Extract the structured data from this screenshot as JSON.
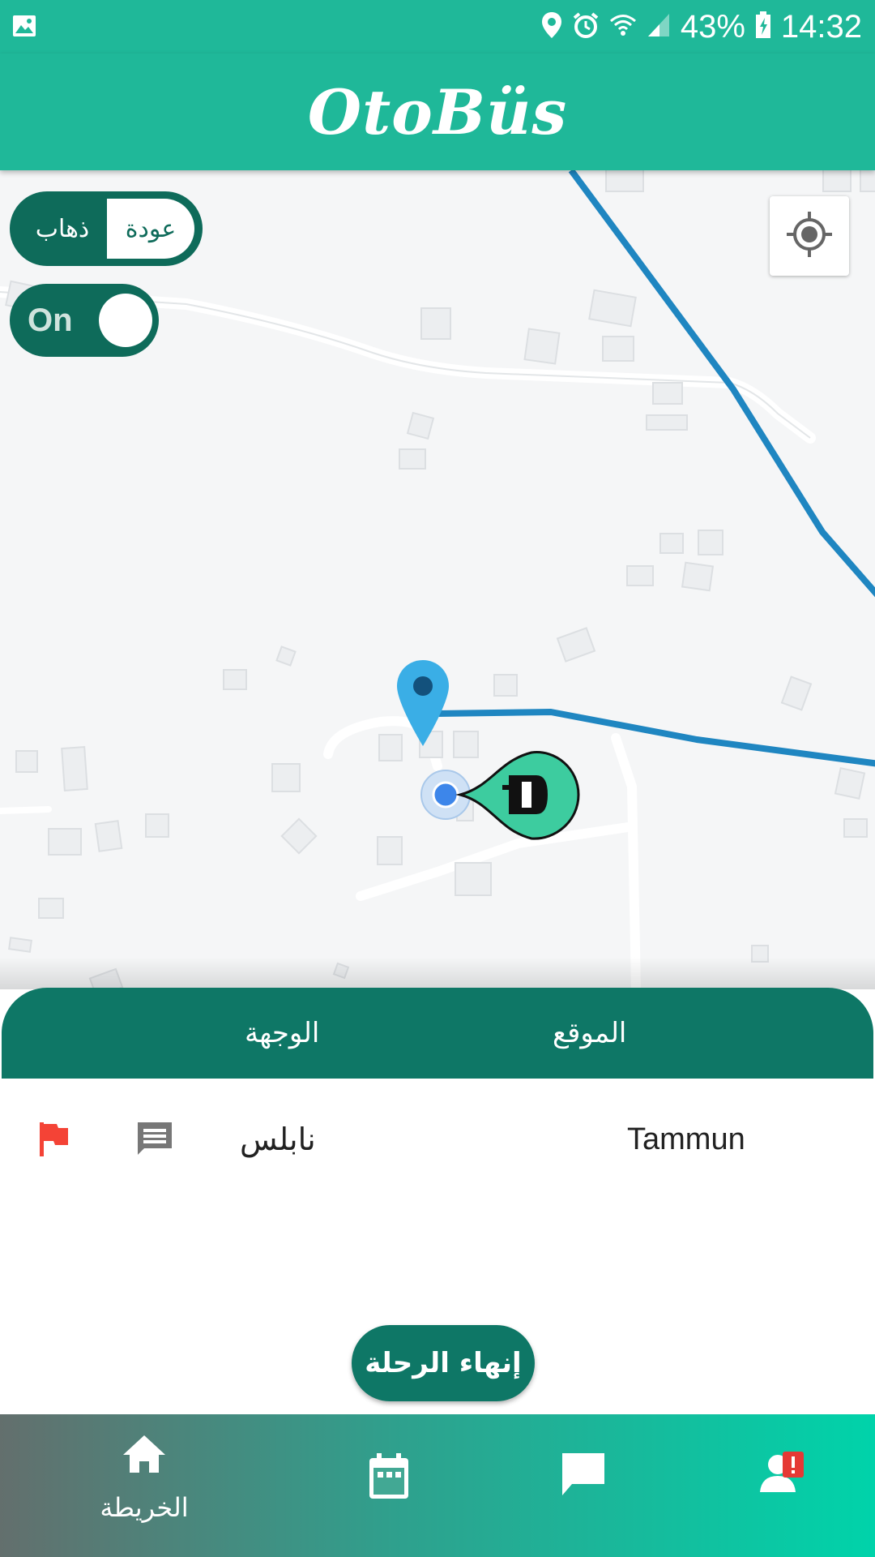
{
  "status_bar": {
    "battery": "43%",
    "time": "14:32",
    "icons": [
      "image-icon",
      "location-icon",
      "alarm-icon",
      "wifi-icon",
      "signal-icon",
      "battery-charging-icon"
    ]
  },
  "app_bar": {
    "title": "OtoBüs"
  },
  "map": {
    "direction_toggle": {
      "return_label": "عودة",
      "going_label": "ذهاب",
      "selected": "عودة"
    },
    "online_switch": {
      "label": "On",
      "state": "on"
    },
    "locate_button_icon": "my-location-icon",
    "markers": [
      "destination-pin-icon",
      "current-location-dot",
      "bus-driver-marker-icon"
    ],
    "colors": {
      "route": "#1f86c1",
      "pin": "#3aaee6",
      "bus_marker": "#3dcc9f"
    }
  },
  "trip_sheet": {
    "header": {
      "destination_label": "الوجهة",
      "location_label": "الموقع"
    },
    "row": {
      "destination": "نابلس",
      "location": "Tammun"
    },
    "end_trip_button": "إنهاء الرحلة"
  },
  "bottom_nav": {
    "items": [
      {
        "icon": "home-icon",
        "label": "الخريطة"
      },
      {
        "icon": "calendar-icon",
        "label": ""
      },
      {
        "icon": "chat-icon",
        "label": ""
      },
      {
        "icon": "profile-alert-icon",
        "label": ""
      }
    ]
  },
  "colors": {
    "primary": "#1fb899",
    "primary_dark": "#0e7766",
    "flag": "#f44336"
  }
}
